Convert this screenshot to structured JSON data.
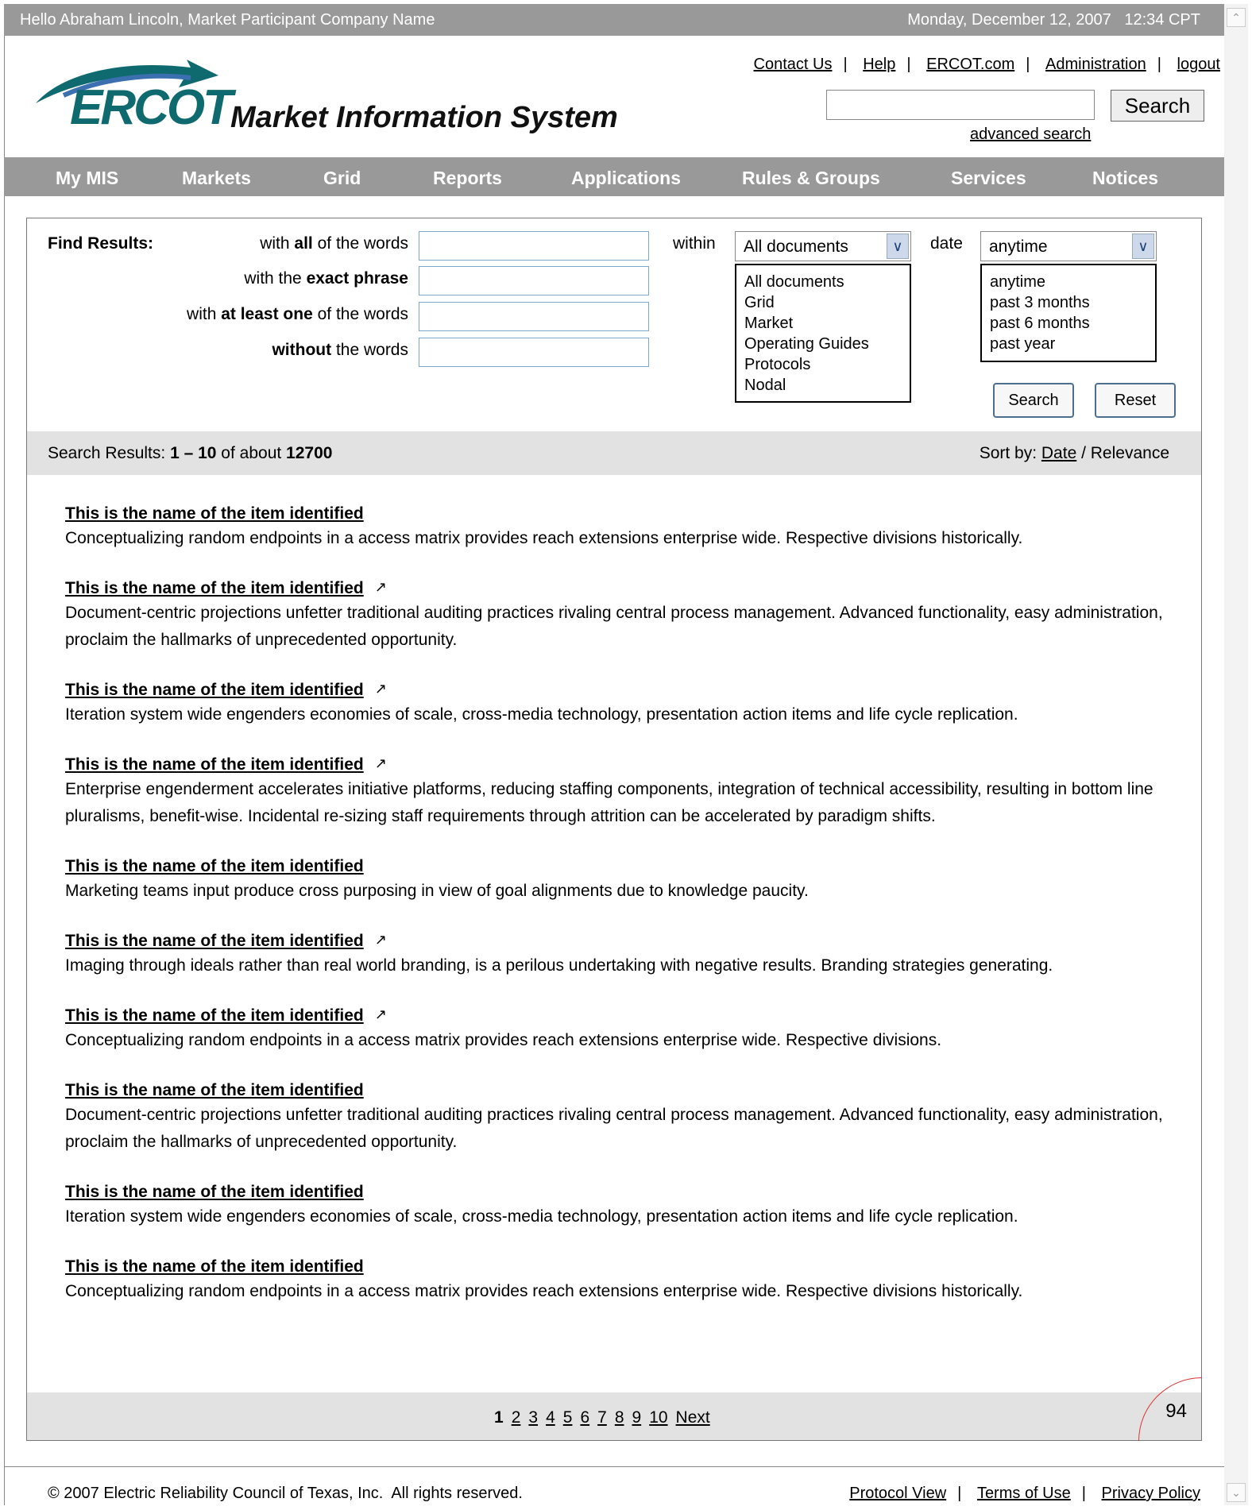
{
  "topbar": {
    "greeting": "Hello Abraham Lincoln, Market Participant Company Name",
    "datetime": "Monday, December 12, 2007   12:34 CPT"
  },
  "header": {
    "logo_text": "ERCOT",
    "title": "Market Information System",
    "links": [
      "Contact Us",
      "Help",
      "ERCOT.com",
      "Administration",
      "logout"
    ],
    "search_button": "Search",
    "advanced_search": "advanced search"
  },
  "nav": [
    "My MIS",
    "Markets",
    "Grid",
    "Reports",
    "Applications",
    "Rules & Groups",
    "Services",
    "Notices"
  ],
  "find": {
    "heading": "Find Results:",
    "all_words": {
      "pre": "with ",
      "bold": "all",
      "post": " of the words"
    },
    "exact_phrase": {
      "pre": "with the ",
      "bold": "exact phrase",
      "post": ""
    },
    "at_least_one": {
      "pre": "with ",
      "bold": "at least one",
      "post": " of the words"
    },
    "without": {
      "pre": "",
      "bold": "without",
      "post": " the words"
    },
    "within_label": "within",
    "within_value": "All documents",
    "within_options": [
      "All documents",
      "Grid",
      "Market",
      "Operating Guides",
      "Protocols",
      "Nodal"
    ],
    "date_label": "date",
    "date_value": "anytime",
    "date_options": [
      "anytime",
      "past 3 months",
      "past 6 months",
      "past year"
    ],
    "search_button": "Search",
    "reset_button": "Reset"
  },
  "results_bar": {
    "prefix": "Search Results: ",
    "range": "1 – 10",
    "mid": " of about ",
    "total": "12700",
    "sort_prefix": "Sort by: ",
    "sort_date": "Date",
    "sort_sep": " / ",
    "sort_relevance": "Relevance"
  },
  "results": [
    {
      "title": "This is the name of the item identified",
      "external": false,
      "desc": "Conceptualizing random endpoints in a access matrix provides reach extensions enterprise wide. Respective divisions historically."
    },
    {
      "title": "This is the name of the item identified",
      "external": true,
      "desc": "Document-centric projections unfetter traditional auditing practices rivaling central process management. Advanced functionality, easy administration, proclaim the hallmarks of unprecedented opportunity."
    },
    {
      "title": "This is the name of the item identified",
      "external": true,
      "desc": "Iteration system wide engenders economies of scale, cross-media technology, presentation action items and life cycle replication."
    },
    {
      "title": "This is the name of the item identified",
      "external": true,
      "desc": "Enterprise engenderment accelerates initiative platforms, reducing staffing components, integration of technical accessibility, resulting in bottom line pluralisms, benefit-wise. Incidental re-sizing staff requirements through attrition can be accelerated by paradigm shifts."
    },
    {
      "title": "This is the name of the item identified",
      "external": false,
      "desc": "Marketing teams input produce cross purposing in view of goal alignments due to knowledge paucity."
    },
    {
      "title": "This is the name of the item identified",
      "external": true,
      "desc": "Imaging through ideals rather than real world branding, is a perilous undertaking with negative results. Branding strategies generating."
    },
    {
      "title": "This is the name of the item identified",
      "external": true,
      "desc": "Conceptualizing random endpoints in a access matrix provides reach extensions enterprise wide. Respective divisions."
    },
    {
      "title": "This is the name of the item identified",
      "external": false,
      "desc": "Document-centric projections unfetter traditional auditing practices rivaling central process management. Advanced functionality, easy administration, proclaim the hallmarks of unprecedented opportunity."
    },
    {
      "title": "This is the name of the item identified",
      "external": false,
      "desc": "Iteration system wide engenders economies of scale, cross-media technology, presentation action items and life cycle replication."
    },
    {
      "title": "This is the name of the item identified",
      "external": false,
      "desc": "Conceptualizing random endpoints in a access matrix provides reach extensions enterprise wide. Respective divisions historically."
    }
  ],
  "pager": {
    "current": "1",
    "pages": [
      "2",
      "3",
      "4",
      "5",
      "6",
      "7",
      "8",
      "9",
      "10"
    ],
    "next": "Next"
  },
  "page_number": "94",
  "footer": {
    "copyright": "© 2007 Electric Reliability Council of Texas, Inc.  All rights reserved.",
    "links": [
      "Protocol View",
      "Terms of Use",
      "Privacy Policy"
    ]
  },
  "colors": {
    "bar": "#999999",
    "logo": "#0f6a6f",
    "results_bg": "#e2e2e2"
  }
}
